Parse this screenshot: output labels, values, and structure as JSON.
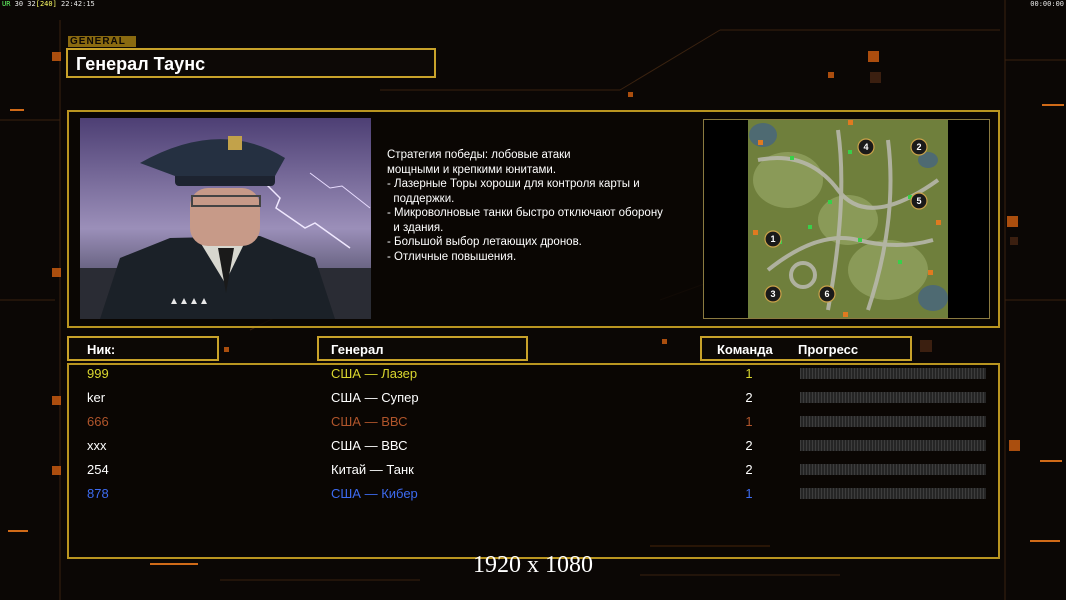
{
  "hud": {
    "left_prefix": "UR",
    "left_fps": "30 32",
    "left_bracket": "[240]",
    "left_time": "22:42:15",
    "right_time": "00:00:00"
  },
  "general": {
    "tag": "GENERAL",
    "name": "Генерал Таунс"
  },
  "description": [
    "Стратегия победы: лобовые атаки",
    "мощными и крепкими юнитами.",
    "",
    "- Лазерные Торы хороши для контроля карты и",
    "  поддержки.",
    "- Микроволновые танки быстро отключают оборону",
    "  и здания.",
    "",
    "- Большой выбор летающих дронов.",
    "- Отличные повышения."
  ],
  "map": {
    "start_positions": [
      "4",
      "2",
      "5",
      "1",
      "3",
      "6"
    ]
  },
  "headers": {
    "nick": "Ник:",
    "general": "Генерал",
    "team": "Команда",
    "progress": "Прогресс"
  },
  "players": [
    {
      "nick": "999",
      "general": "США — Лазер",
      "team": "1",
      "progress": 0,
      "color": "#d9d62e"
    },
    {
      "nick": "ker",
      "general": "США — Супер",
      "team": "2",
      "progress": 0,
      "color": "#ffffff"
    },
    {
      "nick": "666",
      "general": "США — ВВС",
      "team": "1",
      "progress": 0,
      "color": "#b0552b"
    },
    {
      "nick": "xxx",
      "general": "США — ВВС",
      "team": "2",
      "progress": 0,
      "color": "#ffffff"
    },
    {
      "nick": "254",
      "general": "Китай — Танк",
      "team": "2",
      "progress": 0,
      "color": "#ffffff"
    },
    {
      "nick": "878",
      "general": "США — Кибер",
      "team": "1",
      "progress": 0,
      "color": "#3d6bf0"
    }
  ],
  "resolution_text": "1920 x 1080",
  "colors": {
    "accent_gold": "#c8a22a",
    "background": "#0b0705",
    "decor_orange": "#ff7a1a"
  }
}
